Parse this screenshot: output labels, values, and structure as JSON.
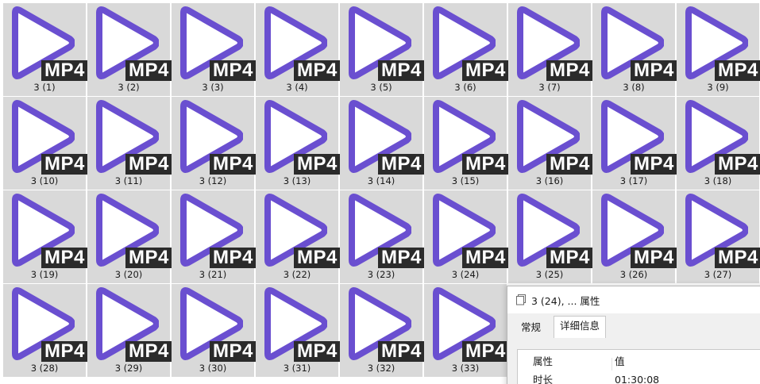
{
  "colors": {
    "tile_background": "#d9d9d9",
    "play_stroke": "#6a4fd0",
    "badge_background": "#2b2b2b"
  },
  "file_icon": {
    "icon": "play-triangle-icon",
    "badge": "MP4"
  },
  "files": [
    {
      "name": "3 (1)"
    },
    {
      "name": "3 (2)"
    },
    {
      "name": "3 (3)"
    },
    {
      "name": "3 (4)"
    },
    {
      "name": "3 (5)"
    },
    {
      "name": "3 (6)"
    },
    {
      "name": "3 (7)"
    },
    {
      "name": "3 (8)"
    },
    {
      "name": "3 (9)"
    },
    {
      "name": "3 (10)"
    },
    {
      "name": "3 (11)"
    },
    {
      "name": "3 (12)"
    },
    {
      "name": "3 (13)"
    },
    {
      "name": "3 (14)"
    },
    {
      "name": "3 (15)"
    },
    {
      "name": "3 (16)"
    },
    {
      "name": "3 (17)"
    },
    {
      "name": "3 (18)"
    },
    {
      "name": "3 (19)"
    },
    {
      "name": "3 (20)"
    },
    {
      "name": "3 (21)"
    },
    {
      "name": "3 (22)"
    },
    {
      "name": "3 (23)"
    },
    {
      "name": "3 (24)"
    },
    {
      "name": "3 (25)"
    },
    {
      "name": "3 (26)"
    },
    {
      "name": "3 (27)"
    },
    {
      "name": "3 (28)"
    },
    {
      "name": "3 (29)"
    },
    {
      "name": "3 (30)"
    },
    {
      "name": "3 (31)"
    },
    {
      "name": "3 (32)"
    },
    {
      "name": "3 (33)"
    }
  ],
  "dialog": {
    "title": "3 (24), ... 属性",
    "tabs": [
      {
        "label": "常规",
        "active": false
      },
      {
        "label": "详细信息",
        "active": true
      }
    ],
    "columns": {
      "property": "属性",
      "value": "值"
    },
    "rows": [
      {
        "property": "时长",
        "value": "01:30:08"
      }
    ]
  }
}
